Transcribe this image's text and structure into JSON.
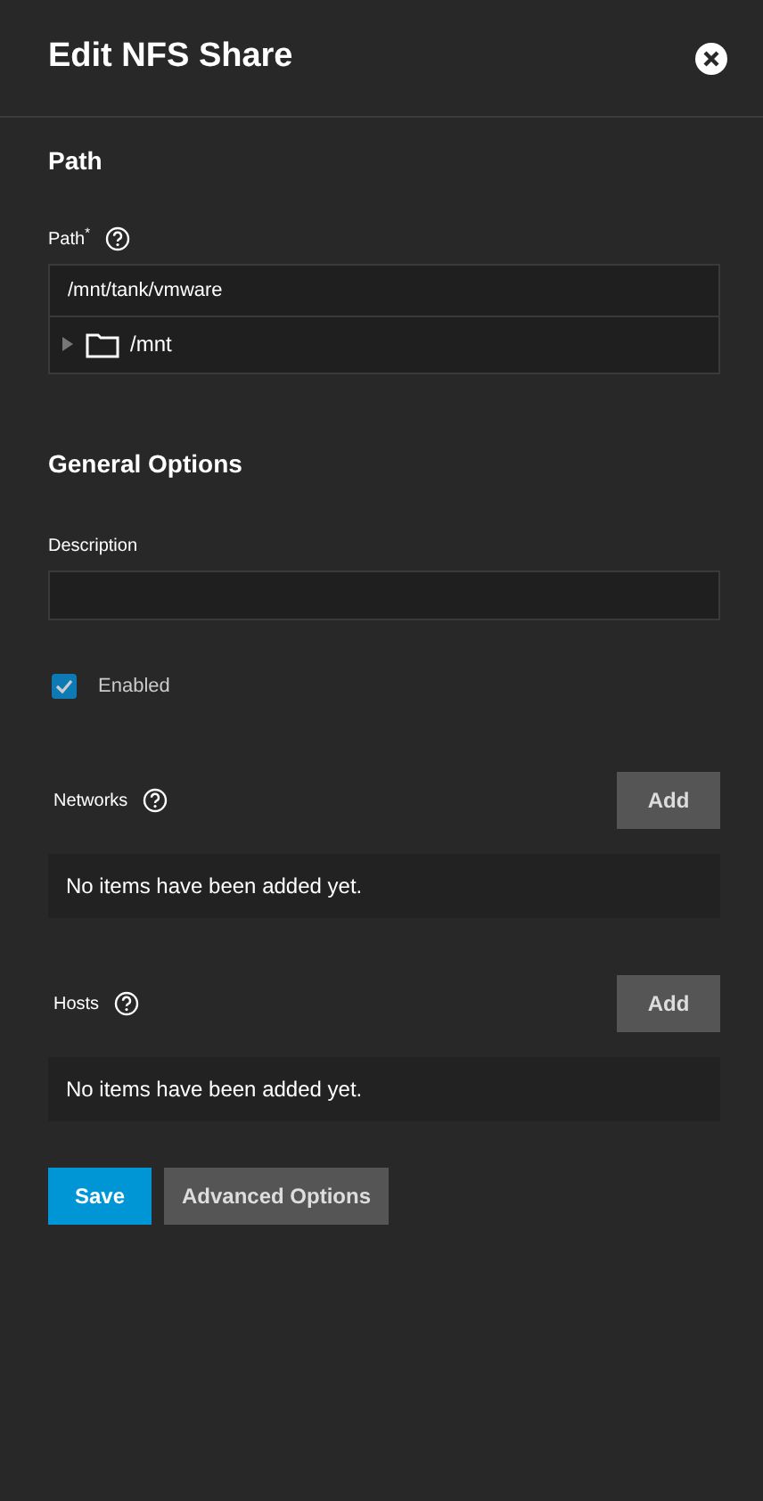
{
  "window": {
    "title": "Edit NFS Share"
  },
  "path_section": {
    "heading": "Path",
    "field": {
      "label": "Path",
      "required_mark": "*",
      "value": "/mnt/tank/vmware"
    },
    "tree": [
      {
        "label": "/mnt",
        "expanded": false
      }
    ]
  },
  "general_section": {
    "heading": "General Options",
    "description": {
      "label": "Description"
    },
    "enabled": {
      "label": "Enabled",
      "checked": true
    }
  },
  "lists": [
    {
      "label": "Networks",
      "button": "Add",
      "empty_text": "No items have been added yet."
    },
    {
      "label": "Hosts",
      "button": "Add",
      "empty_text": "No items have been added yet."
    }
  ],
  "buttons": [
    {
      "label": "Save",
      "kind": "primary"
    },
    {
      "label": "Advanced Options",
      "kind": "secondary"
    }
  ]
}
